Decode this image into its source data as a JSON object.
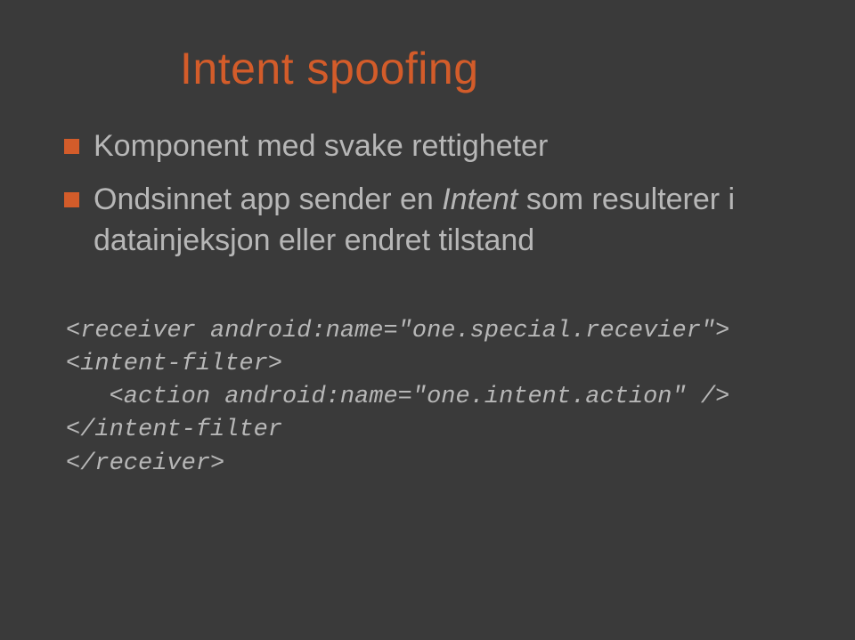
{
  "slide": {
    "title": "Intent spoofing",
    "bullets": [
      {
        "text_html": "Komponent med svake rettigheter"
      },
      {
        "text_html": "Ondsinnet app sender en <span class=\"italic\">Intent</span> som resulterer i datainjeksjon eller endret tilstand"
      }
    ],
    "code": "<receiver android:name=\"one.special.recevier\">\n<intent-filter>\n   <action android:name=\"one.intent.action\" />\n</intent-filter\n</receiver>"
  }
}
